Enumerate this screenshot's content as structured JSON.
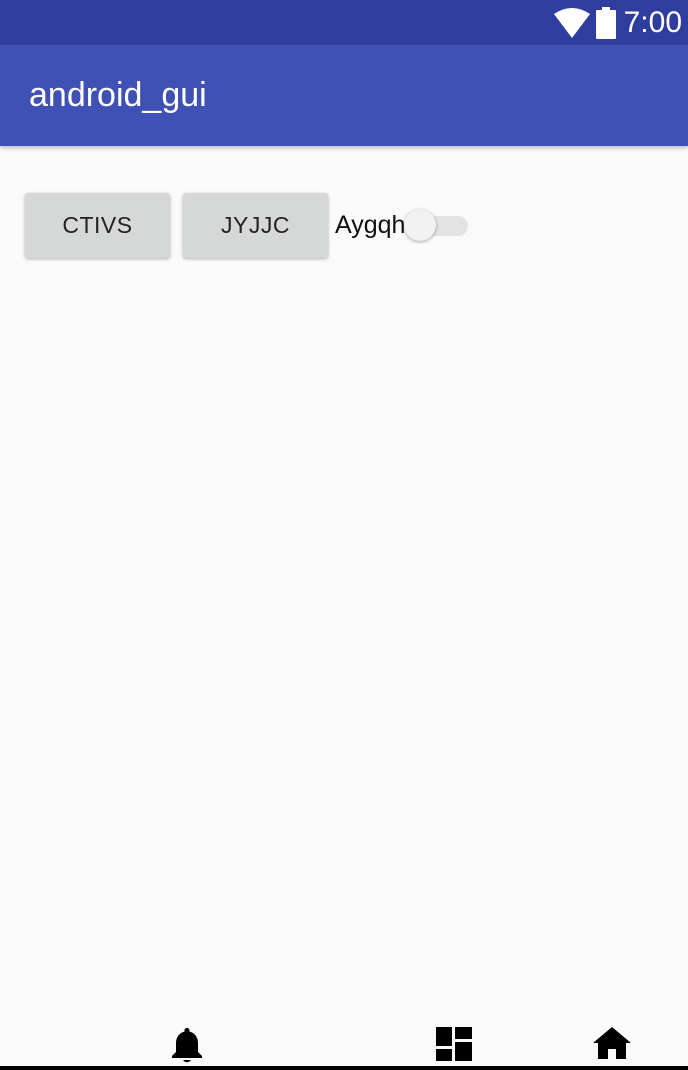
{
  "status_bar": {
    "time": "7:00",
    "icons": [
      "wifi-icon",
      "battery-icon"
    ],
    "color": "#2f3e9e"
  },
  "app_bar": {
    "title": "android_gui",
    "color": "#3f51b5"
  },
  "content": {
    "buttons": [
      {
        "label": "CTIVS"
      },
      {
        "label": "JYJJC"
      }
    ],
    "switch": {
      "label": "Aygqh",
      "checked": false
    }
  },
  "bottom_nav": {
    "icons": [
      "bell-icon",
      "dashboard-icon",
      "home-icon"
    ]
  }
}
